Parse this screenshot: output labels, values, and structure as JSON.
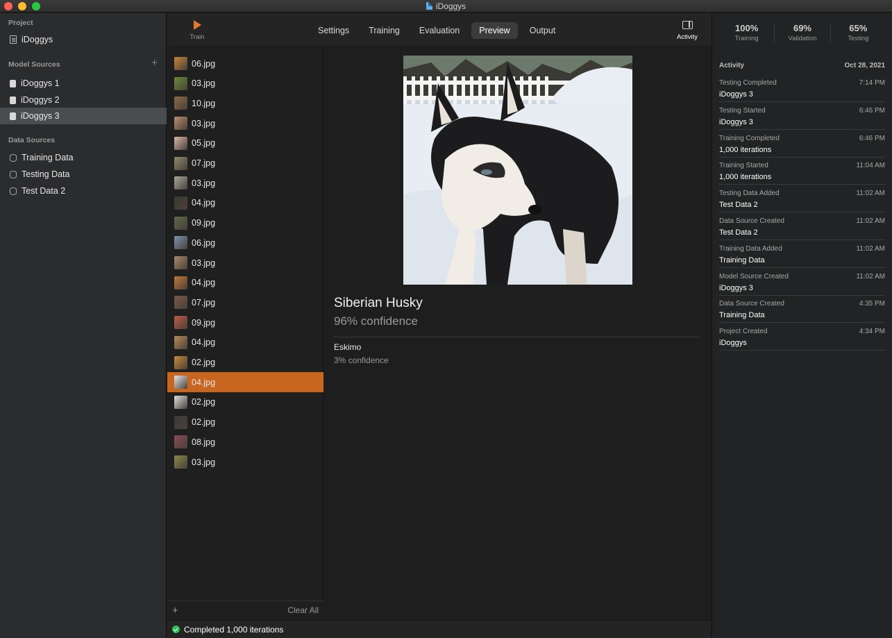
{
  "window": {
    "title": "iDoggys"
  },
  "sidebar": {
    "project_header": "Project",
    "project_name": "iDoggys",
    "model_sources_header": "Model Sources",
    "add_icon": "plus-icon",
    "model_sources": [
      "iDoggys 1",
      "iDoggys 2",
      "iDoggys 3"
    ],
    "selected_model_source": "iDoggys 3",
    "data_sources_header": "Data Sources",
    "data_sources": [
      "Training Data",
      "Testing Data",
      "Test Data 2"
    ]
  },
  "toolbar": {
    "train_label": "Train",
    "tabs": [
      "Settings",
      "Training",
      "Evaluation",
      "Preview",
      "Output"
    ],
    "active_tab": "Preview",
    "activity_label": "Activity"
  },
  "files": [
    "06.jpg",
    "03.jpg",
    "10.jpg",
    "03.jpg",
    "05.jpg",
    "07.jpg",
    "03.jpg",
    "04.jpg",
    "09.jpg",
    "06.jpg",
    "03.jpg",
    "04.jpg",
    "07.jpg",
    "09.jpg",
    "04.jpg",
    "02.jpg",
    "04.jpg",
    "02.jpg",
    "02.jpg",
    "08.jpg",
    "03.jpg"
  ],
  "selected_file_index": 16,
  "file_list_footer": {
    "clear_label": "Clear All"
  },
  "preview": {
    "top_label": "Siberian Husky",
    "top_confidence": "96% confidence",
    "alt_label": "Eskimo",
    "alt_confidence": "3% confidence"
  },
  "status": {
    "text": "Completed 1,000 iterations",
    "color": "#30c05a"
  },
  "metrics": [
    {
      "value": "100%",
      "label": "Training"
    },
    {
      "value": "69%",
      "label": "Validation"
    },
    {
      "value": "65%",
      "label": "Testing"
    }
  ],
  "activity": {
    "header": "Activity",
    "date": "Oct 28, 2021",
    "entries": [
      {
        "event": "Testing Completed",
        "time": "7:14 PM",
        "subject": "iDoggys 3"
      },
      {
        "event": "Testing Started",
        "time": "6:46 PM",
        "subject": "iDoggys 3"
      },
      {
        "event": "Training Completed",
        "time": "6:46 PM",
        "subject": "1,000 iterations"
      },
      {
        "event": "Training Started",
        "time": "11:04 AM",
        "subject": "1,000 iterations"
      },
      {
        "event": "Testing Data Added",
        "time": "11:02 AM",
        "subject": "Test Data 2"
      },
      {
        "event": "Data Source Created",
        "time": "11:02 AM",
        "subject": "Test Data 2"
      },
      {
        "event": "Training Data Added",
        "time": "11:02 AM",
        "subject": "Training Data"
      },
      {
        "event": "Model Source Created",
        "time": "11:02 AM",
        "subject": "iDoggys 3"
      },
      {
        "event": "Data Source Created",
        "time": "4:35 PM",
        "subject": "Training Data"
      },
      {
        "event": "Project Created",
        "time": "4:34 PM",
        "subject": "iDoggys"
      }
    ]
  },
  "colors": {
    "accent": "#c8651f",
    "play": "#e07b2d"
  }
}
